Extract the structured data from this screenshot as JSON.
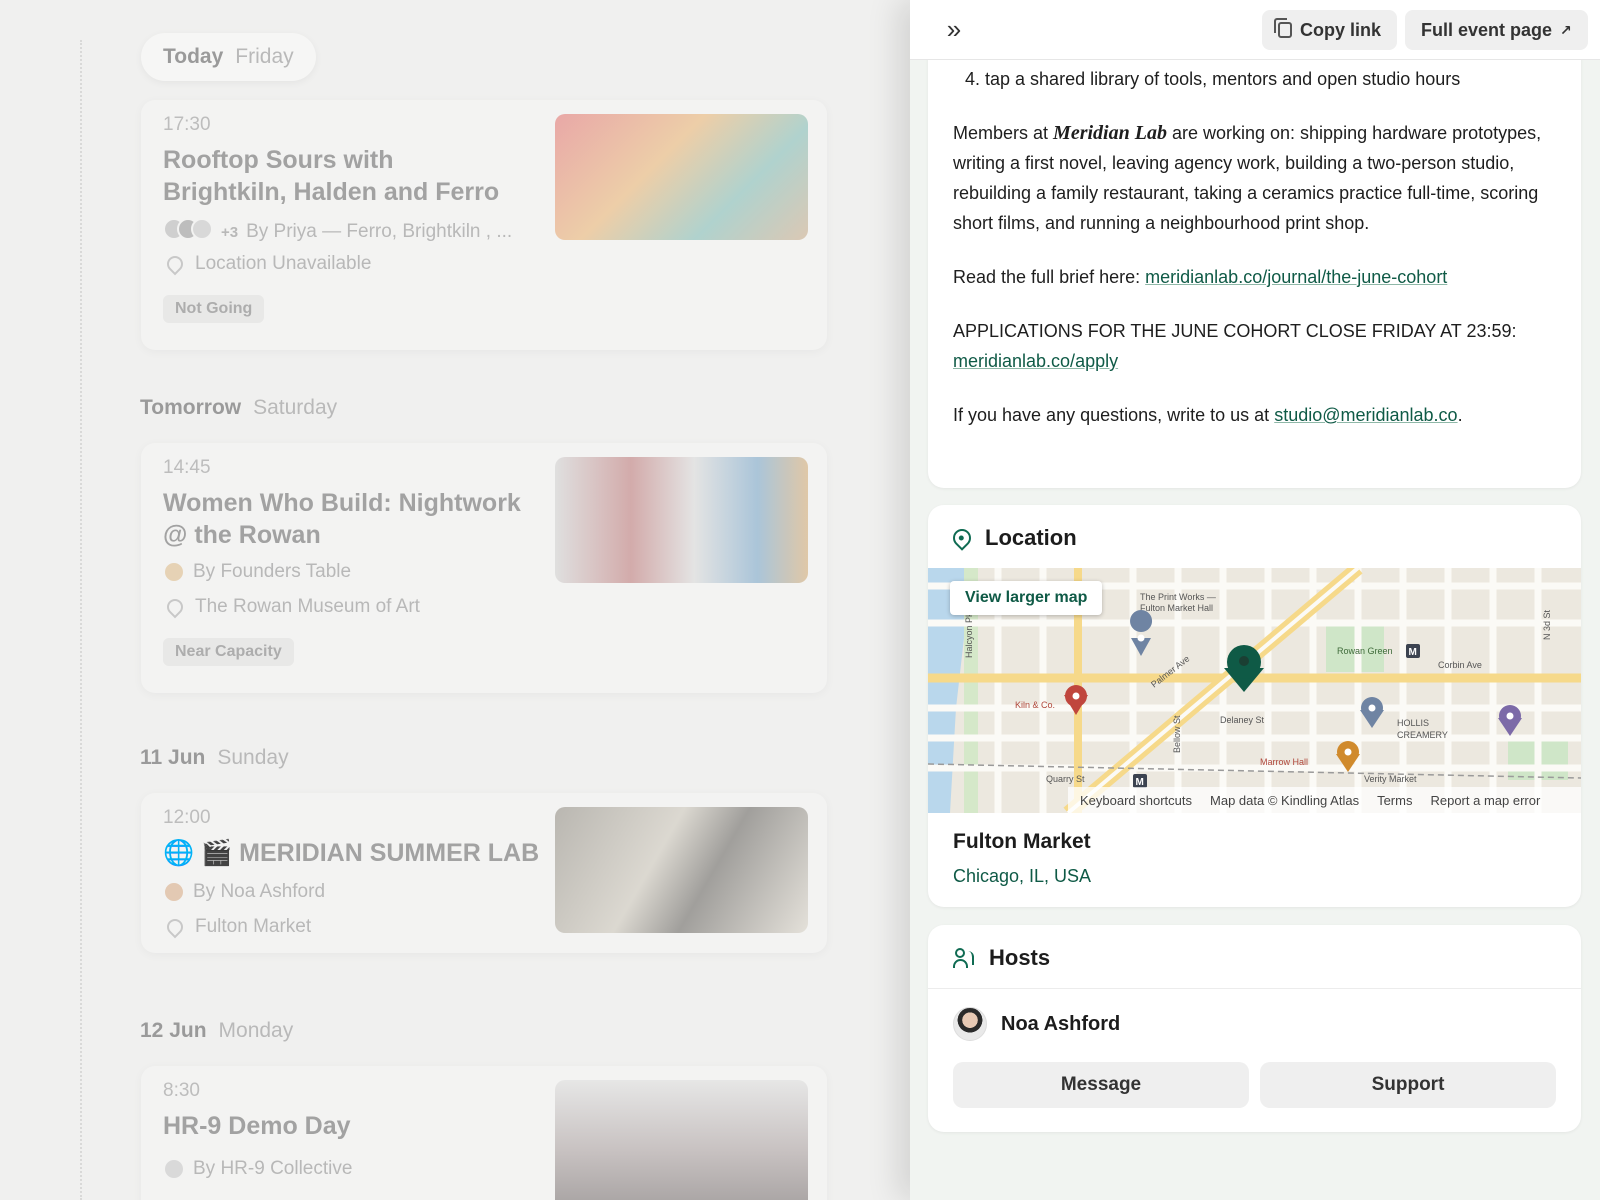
{
  "calendar": {
    "days": [
      {
        "main": "Today",
        "sub": "Friday"
      },
      {
        "main": "Tomorrow",
        "sub": "Saturday"
      },
      {
        "main": "11 Jun",
        "sub": "Sunday"
      },
      {
        "main": "12 Jun",
        "sub": "Monday"
      }
    ],
    "events": [
      {
        "time": "17:30",
        "title": "Rooftop Sours with Brightkiln, Halden and Ferro",
        "extra_count": "+3",
        "by": "By Priya — Ferro, Brightkiln , ...",
        "location": "Location Unavailable",
        "status": "Not Going"
      },
      {
        "time": "14:45",
        "title": "Women Who Build: Nightwork @ the Rowan",
        "by": "By Founders Table",
        "location": "The Rowan Museum of Art",
        "status": "Near Capacity"
      },
      {
        "time": "12:00",
        "title": "🌐 🎬 MERIDIAN SUMMER LAB",
        "by": "By Noa Ashford",
        "location": "Fulton Market"
      },
      {
        "time": "8:30",
        "title": "HR-9 Demo Day",
        "by": "By HR-9 Collective"
      }
    ]
  },
  "toolbar": {
    "expand_icon": "double-chevron-right-icon",
    "copy_link": "Copy link",
    "full_event_page": "Full event page",
    "external_arrow": "↗"
  },
  "about": {
    "list_item_4": "4. tap a shared library of tools, mentors and open studio hours",
    "members_prefix": "Members at",
    "members_brand": "Meridian Lab",
    "members_rest": "are working on: shipping hardware prototypes, writing a first novel, leaving agency work, building a two-person studio, rebuilding a family restaurant, taking a ceramics practice full-time, scoring short films, and running a neighbourhood print shop.",
    "brief_prefix": "Read the full brief here:",
    "brief_link": "meridianlab.co/journal/the-june-cohort",
    "apply_text": "APPLICATIONS FOR THE JUNE COHORT CLOSE FRIDAY AT 23:59:",
    "apply_link": "meridianlab.co/apply",
    "questions_prefix": "If you have any questions, write to us at",
    "questions_email": "studio@meridianlab.co",
    "questions_suffix": "."
  },
  "location": {
    "heading": "Location",
    "view_larger_map": "View larger map",
    "map_labels": {
      "print_works": "The Print Works —",
      "print_works_2": "Fulton Market Hall",
      "rowan_green": "Rowan Green",
      "corbin_ave": "Corbin Ave",
      "palmer_ave": "Palmer Ave",
      "kiln_co": "Kiln & Co.",
      "delaney_st": "Delaney St",
      "bellow_st": "Bellow St",
      "hollis": "HOLLIS",
      "creamery": "CREAMERY",
      "marrow_hall": "Marrow Hall",
      "quarry_st": "Quarry St",
      "verity_market": "Verity Market",
      "halcyon_pkwy": "Halcyon Pkwy",
      "n3d_st": "N 3d St",
      "metro": "M"
    },
    "map_footer": {
      "shortcuts": "Keyboard shortcuts",
      "data": "Map data © Kindling Atlas",
      "terms": "Terms",
      "report": "Report a map error"
    },
    "venue_name": "Fulton Market",
    "venue_city": "Chicago, IL, USA",
    "colors": {
      "accent": "#0f5a46",
      "road": "#f6d98a",
      "park": "#cfe6c8",
      "water": "#b9d7ec"
    }
  },
  "hosts": {
    "heading": "Hosts",
    "name": "Noa Ashford",
    "message": "Message",
    "support": "Support"
  }
}
